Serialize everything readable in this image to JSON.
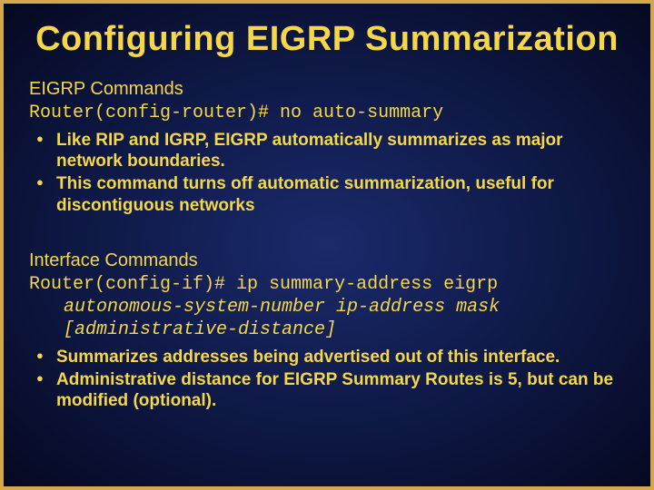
{
  "title": "Configuring EIGRP Summarization",
  "section1": {
    "label": "EIGRP Commands",
    "prompt": "Router(config-router)# ",
    "command": "no auto-summary",
    "bullets": [
      "Like RIP and IGRP, EIGRP automatically summarizes as major network boundaries.",
      "This command turns off automatic summarization, useful for discontiguous networks"
    ]
  },
  "section2": {
    "label": "Interface Commands",
    "prompt": "Router(config-if)# ",
    "command": "ip summary-address eigrp",
    "cont1": "autonomous-system-number ip-address mask",
    "cont2": "[administrative-distance]",
    "bullets": [
      "Summarizes addresses being advertised out of this interface.",
      "Administrative distance for EIGRP Summary Routes is 5, but can be modified (optional)."
    ]
  }
}
